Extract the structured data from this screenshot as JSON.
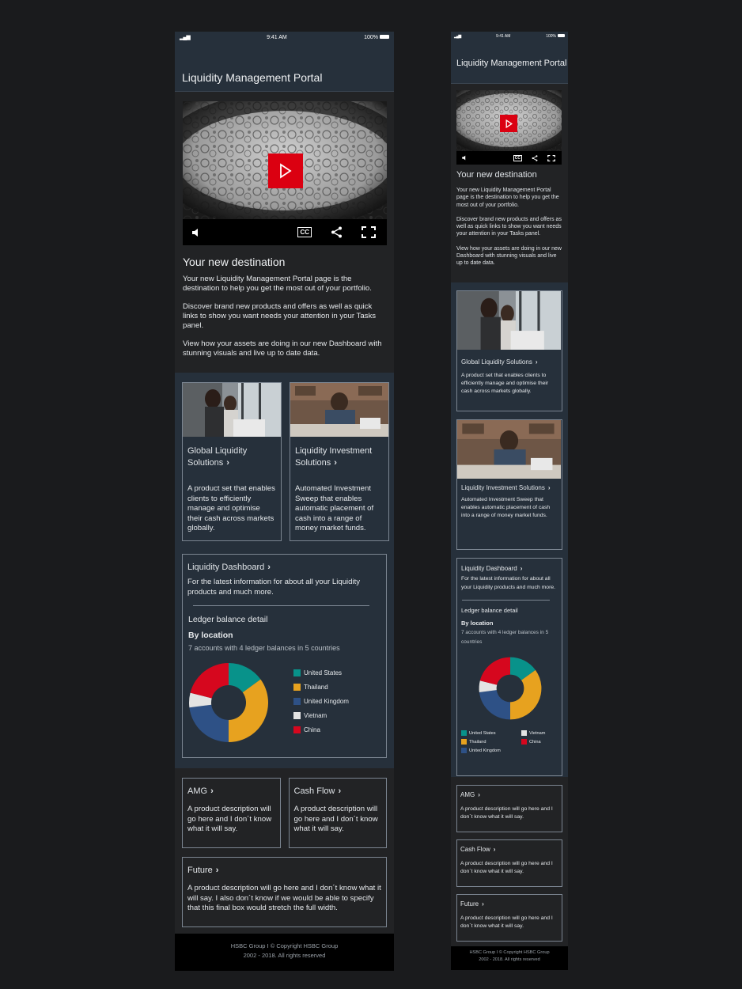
{
  "status": {
    "signal": "▂▄▆",
    "time": "9:41 AM",
    "battery": "100%"
  },
  "header": {
    "title": "Liquidity Management Portal"
  },
  "hero": {
    "title": "Your new destination",
    "para1": "Your new Liquidity Management Portal page is the destination to help you get the most out of your portfolio.",
    "para2": "Discover brand new products and offers as well as quick links to show you want needs your attention in your Tasks panel.",
    "para3": "View how your assets are doing in our new Dashboard with stunning visuals and live up to date data.",
    "video_controls": [
      "volume-icon",
      "closed-captions-icon",
      "share-icon",
      "fullscreen-icon"
    ],
    "cc_label": "CC"
  },
  "cards": [
    {
      "title": "Global Liquidity Solutions",
      "desc": "A product set that enables clients to efficiently manage and optimise their cash across markets globally."
    },
    {
      "title": "Liquidity Investment Solutions",
      "desc": "Automated Investment Sweep that enables automatic placement of cash into a range of money market funds."
    }
  ],
  "dashboard": {
    "title": "Liquidity Dashboard",
    "desc": "For the latest information for about all your Liquidity products and much more.",
    "ledger": "Ledger balance detail",
    "by_location": "By location",
    "accounts": "7 accounts with 4 ledger balances in 5 countries"
  },
  "chart_data": {
    "type": "pie",
    "donut": true,
    "categories": [
      "United States",
      "Thailand",
      "United Kingdom",
      "Vietnam",
      "China"
    ],
    "values": [
      15,
      35,
      23,
      6,
      21
    ],
    "colors": [
      "#08928a",
      "#e7a21f",
      "#2e5186",
      "#e3e3e3",
      "#d6071e"
    ],
    "legend": "right"
  },
  "products": [
    {
      "title": "AMG",
      "desc": "A product description will go here and I don´t know what it will say."
    },
    {
      "title": "Cash Flow",
      "desc": "A product description will go here and I don´t know what it will say."
    }
  ],
  "future": {
    "title": "Future",
    "desc": "A product description will go here and I don´t know what it will say. I also don´t know if we would be able to specify that this final box would stretch the full width.",
    "desc_short": "A product description will go here and I don´t know what it will say."
  },
  "footer": {
    "line1": "HSBC Group  I  © Copyright HSBC Group",
    "line2": "2002 -  2018. All rights reserved"
  },
  "chev": "›"
}
